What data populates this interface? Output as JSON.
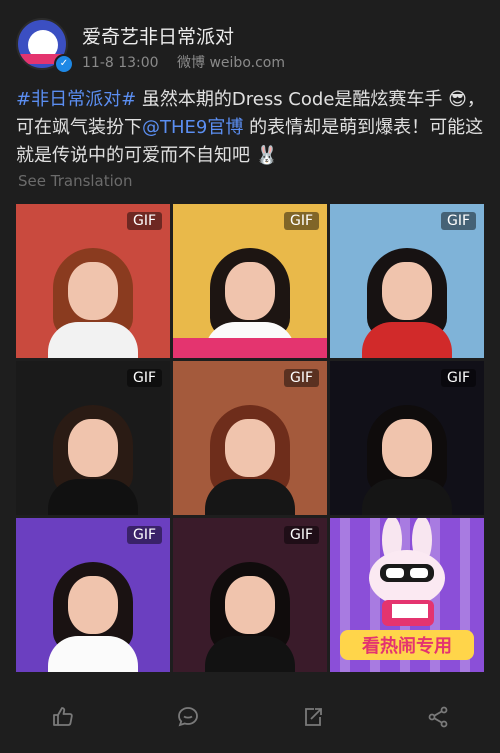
{
  "header": {
    "username": "爱奇艺非日常派对",
    "time": "11-8 13:00",
    "source": "微博 weibo.com",
    "verified_glyph": "✓"
  },
  "post": {
    "hashtag": "#非日常派对#",
    "text_1": " 虽然本期的Dress Code是酷炫赛车手",
    "emoji_1": "😎",
    "text_2": "，可在飒气装扮下",
    "mention": "@THE9官博",
    "text_3": " 的表情却是萌到爆表！可能这就是传说中的可爱而不自知吧",
    "emoji_2": "🐰"
  },
  "translate": "See Translation",
  "grid": {
    "gif_label": "GIF",
    "cells": [
      {
        "gif": true,
        "bg": "#c94a3e",
        "hair": "#8a3b1f",
        "body": "#f2f2f2"
      },
      {
        "gif": true,
        "bg": "#e9b94a",
        "hair": "#1d1512",
        "body": "#fafafa"
      },
      {
        "gif": true,
        "bg": "#7fb3d8",
        "hair": "#171212",
        "body": "#d12a2a"
      },
      {
        "gif": true,
        "bg": "#1a1a1a",
        "hair": "#2a1b14",
        "body": "#111111"
      },
      {
        "gif": true,
        "bg": "#a45a3c",
        "hair": "#6e2d1b",
        "body": "#161616"
      },
      {
        "gif": true,
        "bg": "#111018",
        "hair": "#0f0c0c",
        "body": "#151515"
      },
      {
        "gif": true,
        "bg": "#6b3fc0",
        "hair": "#1a1212",
        "body": "#fbfbfb"
      },
      {
        "gif": true,
        "bg": "#3a1b2a",
        "hair": "#100c0c",
        "body": "#121212"
      },
      {
        "gif": false,
        "bg": "#8b4fd8",
        "hair": "",
        "body": ""
      }
    ],
    "sticker_text": "看热闹专用"
  },
  "actions": {
    "like_icon": "thumbs-up-icon",
    "comment_icon": "comment-icon",
    "repost_icon": "repost-icon",
    "share_icon": "share-icon"
  }
}
